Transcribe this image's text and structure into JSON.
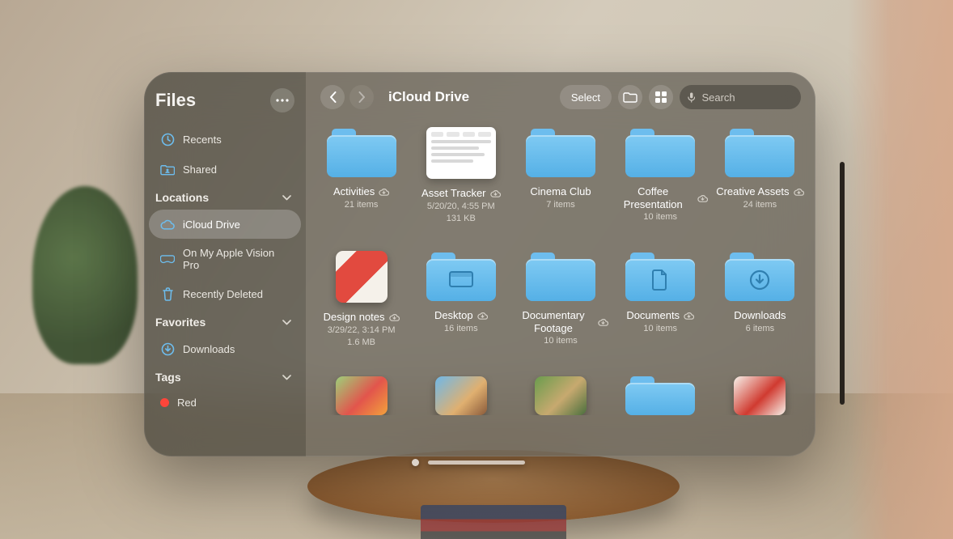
{
  "app": {
    "title": "Files"
  },
  "toolbar": {
    "select_label": "Select",
    "search_placeholder": "Search"
  },
  "breadcrumb": {
    "title": "iCloud Drive"
  },
  "sidebar": {
    "quick": [
      {
        "icon": "clock",
        "label": "Recents"
      },
      {
        "icon": "shared",
        "label": "Shared"
      }
    ],
    "sections": [
      {
        "title": "Locations",
        "items": [
          {
            "icon": "icloud",
            "label": "iCloud Drive",
            "selected": true
          },
          {
            "icon": "vision",
            "label": "On My Apple Vision Pro"
          },
          {
            "icon": "trash",
            "label": "Recently Deleted"
          }
        ]
      },
      {
        "title": "Favorites",
        "items": [
          {
            "icon": "download",
            "label": "Downloads"
          }
        ]
      },
      {
        "title": "Tags",
        "items": [
          {
            "icon": "tag",
            "label": "Red",
            "color": "#ff453a"
          }
        ]
      }
    ]
  },
  "grid": {
    "items": [
      {
        "kind": "folder",
        "name": "Activities",
        "meta1": "21 items",
        "cloud": true
      },
      {
        "kind": "sheet",
        "name": "Asset Tracker",
        "meta1": "5/20/20, 4:55 PM",
        "meta2": "131 KB",
        "cloud": true
      },
      {
        "kind": "folder",
        "name": "Cinema Club",
        "meta1": "7 items"
      },
      {
        "kind": "folder",
        "name": "Coffee Presentation",
        "meta1": "10 items",
        "cloud": true
      },
      {
        "kind": "folder",
        "name": "Creative Assets",
        "meta1": "24 items",
        "cloud": true
      },
      {
        "kind": "image",
        "name": "Design notes",
        "meta1": "3/29/22, 3:14 PM",
        "meta2": "1.6 MB",
        "cloud": true,
        "swatch": "linear-gradient(135deg,#f5f1ea 20%,#e24a3f 20% 60%,#f5f1ea 60%)"
      },
      {
        "kind": "folder",
        "name": "Desktop",
        "meta1": "16 items",
        "glyph": "desktop",
        "cloud": true
      },
      {
        "kind": "folder",
        "name": "Documentary Footage",
        "meta1": "10 items",
        "cloud": true
      },
      {
        "kind": "folder",
        "name": "Documents",
        "meta1": "10 items",
        "glyph": "doc",
        "cloud": true
      },
      {
        "kind": "folder",
        "name": "Downloads",
        "meta1": "6 items",
        "glyph": "download"
      },
      {
        "kind": "image",
        "swatch": "linear-gradient(135deg,#9dd07a,#e2554c 55%,#f3a23c)"
      },
      {
        "kind": "image",
        "swatch": "linear-gradient(135deg,#6fb8e8,#e0b070 60%,#8a5a3a)"
      },
      {
        "kind": "image",
        "swatch": "linear-gradient(135deg,#6a9c4d,#c7a96f 55%,#4a6f3d)"
      },
      {
        "kind": "folder"
      },
      {
        "kind": "image",
        "swatch": "linear-gradient(135deg,#f7f2ea,#d03a30 55%,#f7f2ea)"
      }
    ]
  }
}
